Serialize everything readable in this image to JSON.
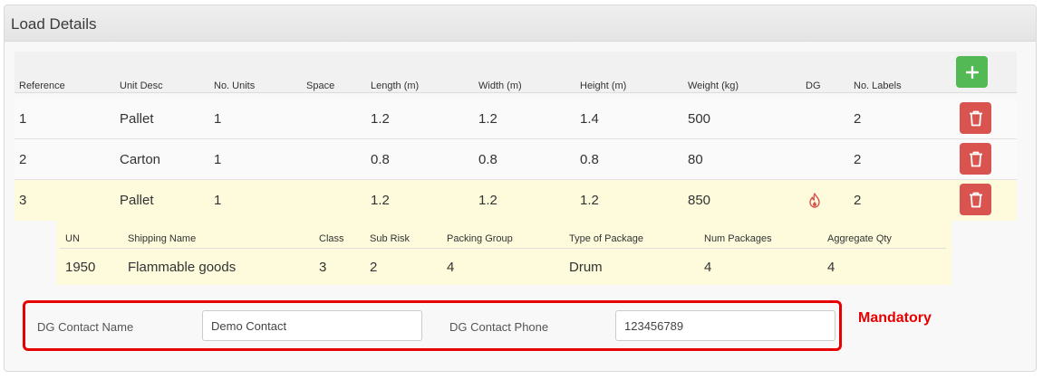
{
  "panel": {
    "title": "Load Details"
  },
  "table": {
    "headers": [
      "Reference",
      "Unit Desc",
      "No. Units",
      "Space",
      "Length (m)",
      "Width (m)",
      "Height (m)",
      "Weight (kg)",
      "DG",
      "No. Labels"
    ],
    "rows": [
      {
        "reference": "1",
        "unit_desc": "Pallet",
        "no_units": "1",
        "space": "",
        "length": "1.2",
        "width": "1.2",
        "height": "1.4",
        "weight": "500",
        "dg": false,
        "labels": "2"
      },
      {
        "reference": "2",
        "unit_desc": "Carton",
        "no_units": "1",
        "space": "",
        "length": "0.8",
        "width": "0.8",
        "height": "0.8",
        "weight": "80",
        "dg": false,
        "labels": "2"
      },
      {
        "reference": "3",
        "unit_desc": "Pallet",
        "no_units": "1",
        "space": "",
        "length": "1.2",
        "width": "1.2",
        "height": "1.2",
        "weight": "850",
        "dg": true,
        "labels": "2"
      }
    ],
    "add_icon": "plus-icon",
    "delete_icon": "trash-icon",
    "dg_icon": "flame-icon"
  },
  "dg_details": {
    "headers": [
      "UN",
      "Shipping Name",
      "Class",
      "Sub Risk",
      "Packing Group",
      "Type of Package",
      "Num Packages",
      "Aggregate Qty"
    ],
    "row": {
      "un": "1950",
      "shipping_name": "Flammable goods",
      "class": "3",
      "sub_risk": "2",
      "packing_group": "4",
      "package_type": "Drum",
      "num_packages": "4",
      "aggregate_qty": "4"
    }
  },
  "dg_contact": {
    "name_label": "DG Contact Name",
    "name_value": "Demo Contact",
    "phone_label": "DG Contact Phone",
    "phone_value": "123456789"
  },
  "annotation": {
    "text": "Mandatory"
  },
  "colors": {
    "add": "#52b954",
    "delete": "#d9534f",
    "highlight": "#fdfbdb",
    "mandatory": "#e60000",
    "dg_icon": "#d9534f"
  }
}
